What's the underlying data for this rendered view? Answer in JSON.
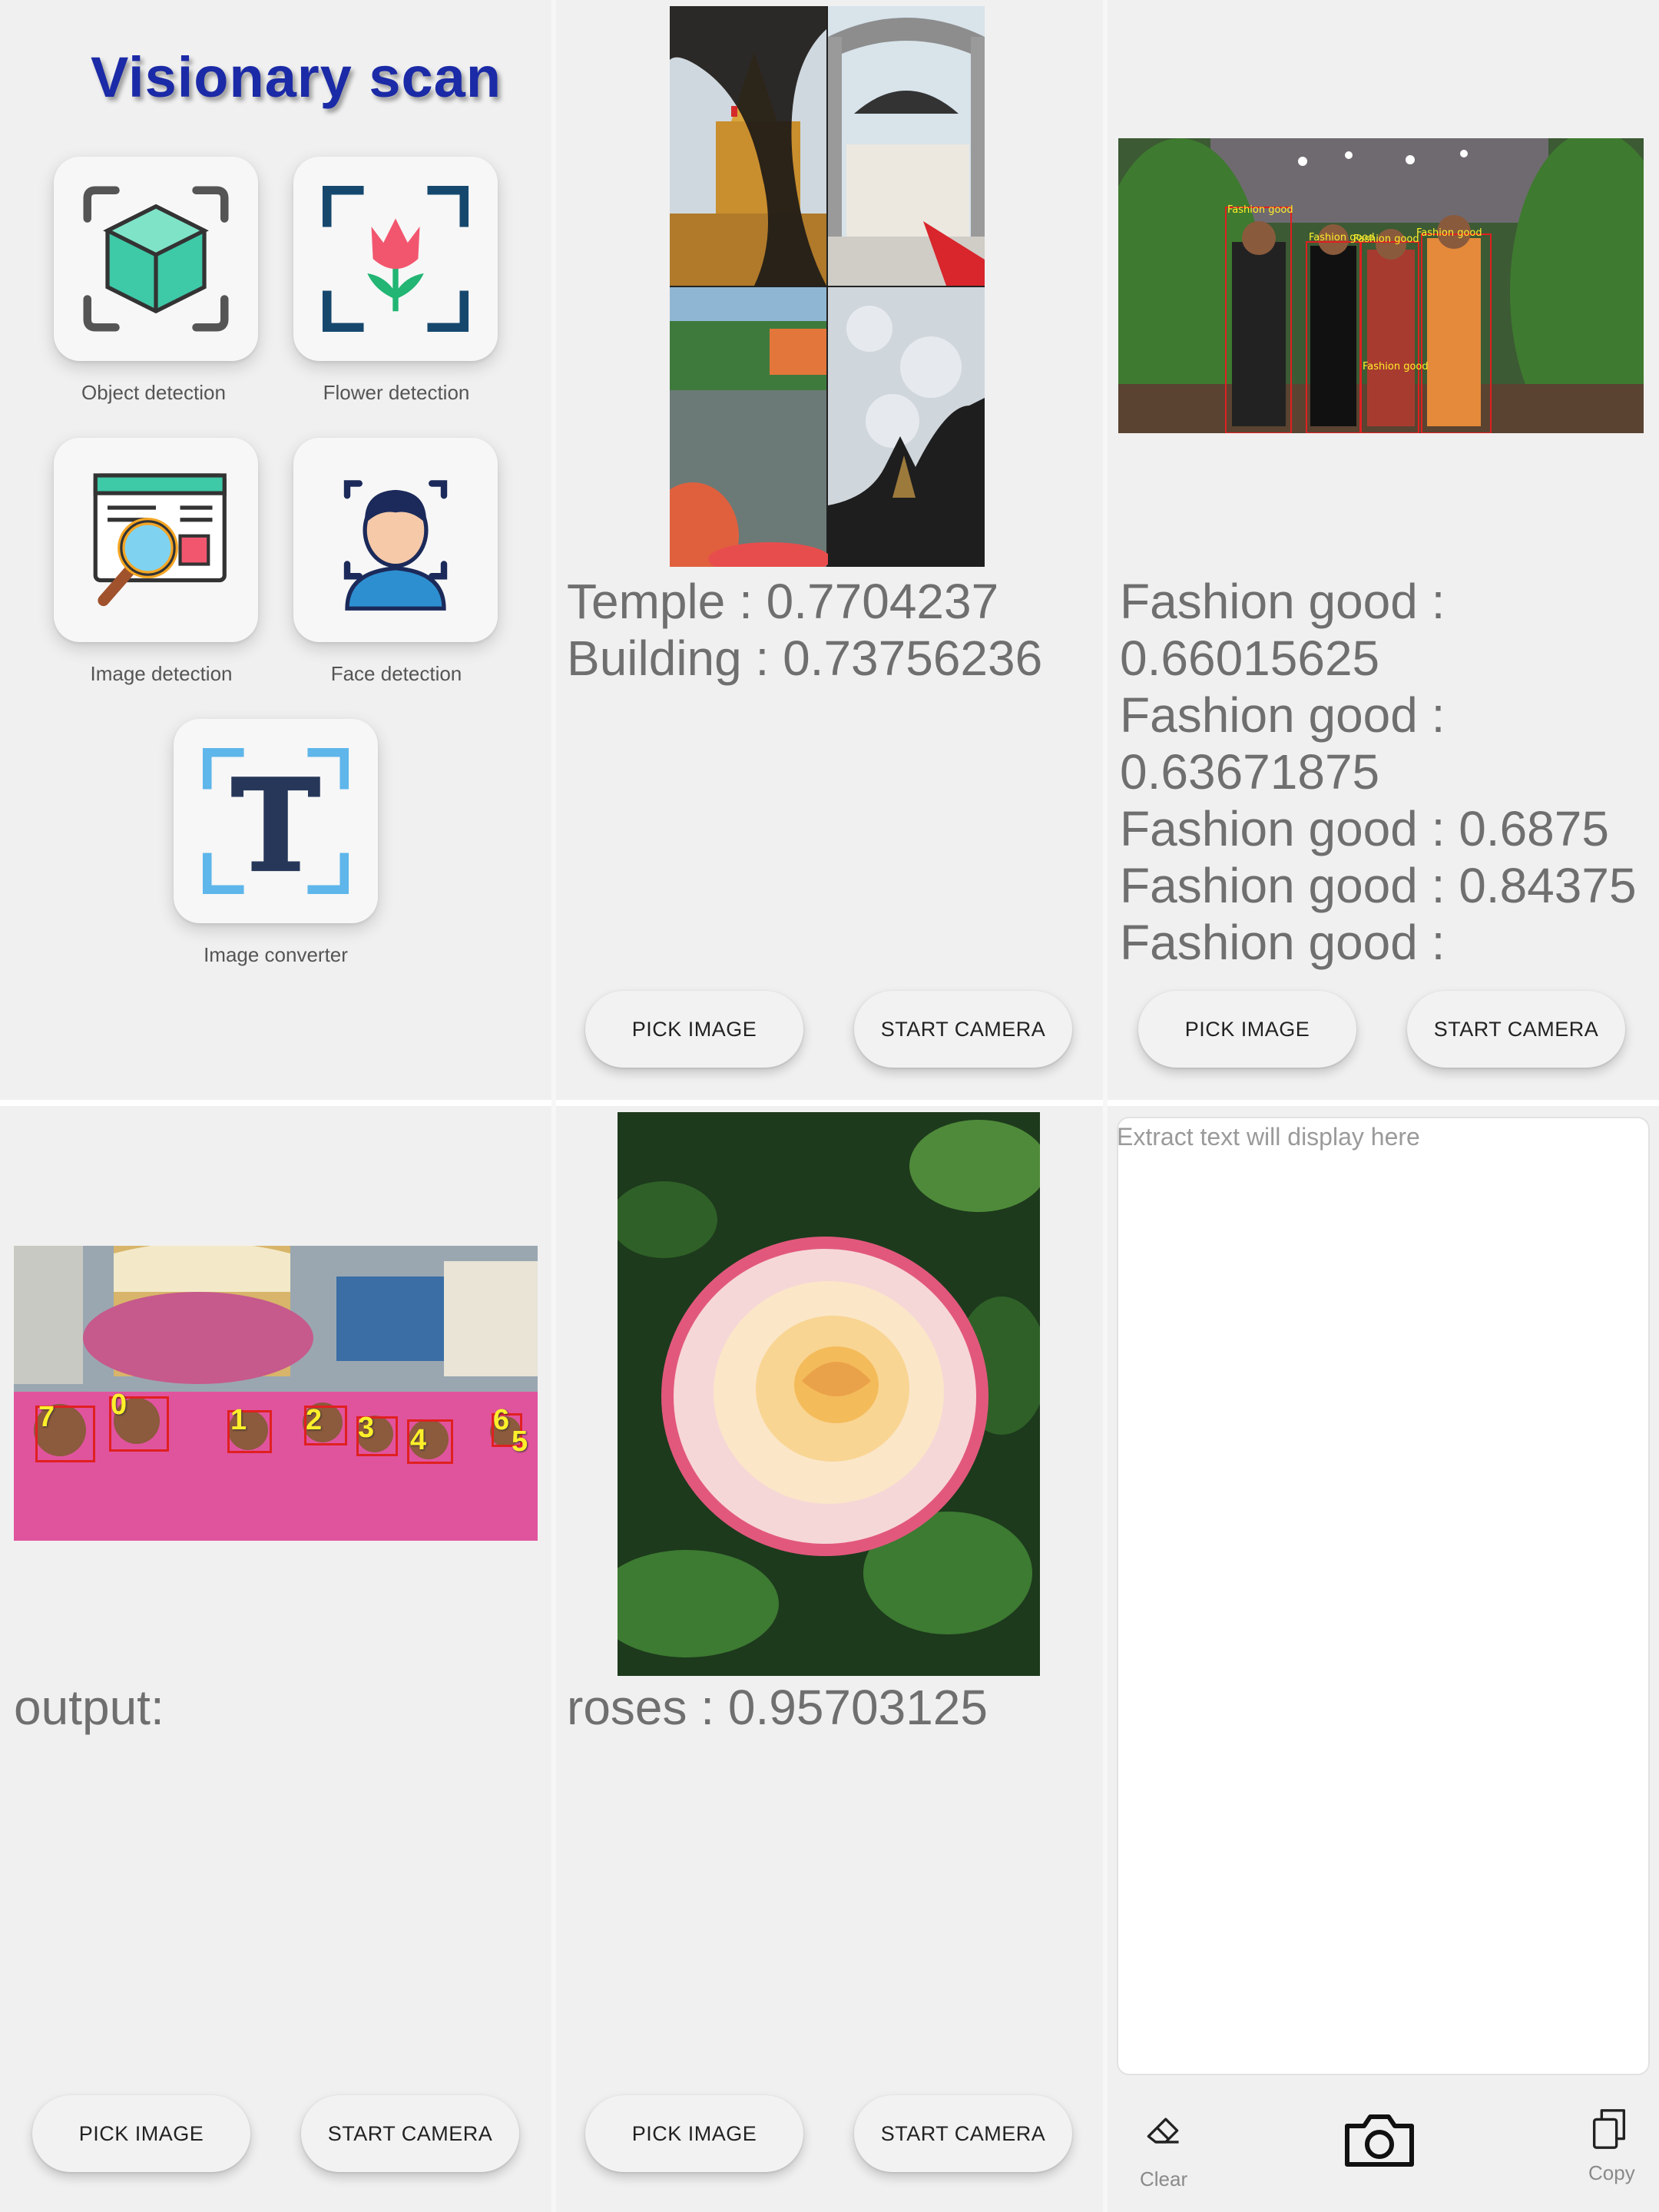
{
  "home": {
    "title": "Visionary scan",
    "cards": [
      {
        "label": "Object detection"
      },
      {
        "label": "Flower detection"
      },
      {
        "label": "Image detection"
      },
      {
        "label": "Face detection"
      },
      {
        "label": "Image converter"
      }
    ]
  },
  "image_labeling": {
    "results": "Temple : 0.7704237\nBuilding : 0.73756236",
    "pick_label": "PICK IMAGE",
    "camera_label": "START CAMERA"
  },
  "object_detection": {
    "box_labels": [
      "Fashion good",
      "Fashion good",
      "Fashion good",
      "Fashion good",
      "Fashion good"
    ],
    "results": "Fashion good :\n0.66015625\nFashion good :\n0.63671875\nFashion good : 0.6875\nFashion good : 0.84375\nFashion good :",
    "pick_label": "PICK IMAGE",
    "camera_label": "START CAMERA"
  },
  "face_detection": {
    "face_numbers": [
      "7",
      "0",
      "1",
      "2",
      "3",
      "4",
      "6",
      "5"
    ],
    "output_label": "output:",
    "pick_label": "PICK IMAGE",
    "camera_label": "START CAMERA"
  },
  "flower_detection": {
    "results": "roses : 0.95703125",
    "pick_label": "PICK IMAGE",
    "camera_label": "START CAMERA"
  },
  "text_converter": {
    "placeholder": "Extract text will display here",
    "clear_label": "Clear",
    "copy_label": "Copy"
  },
  "colors": {
    "title": "#1b2aa6",
    "box": "#e02020",
    "label_yellow": "#ffef2a",
    "background": "#f0f0f0"
  },
  "icons": [
    "cube-scan-icon",
    "tulip-scan-icon",
    "web-search-icon",
    "face-scan-icon",
    "text-scan-icon",
    "eraser-icon",
    "camera-icon",
    "copy-icon"
  ]
}
